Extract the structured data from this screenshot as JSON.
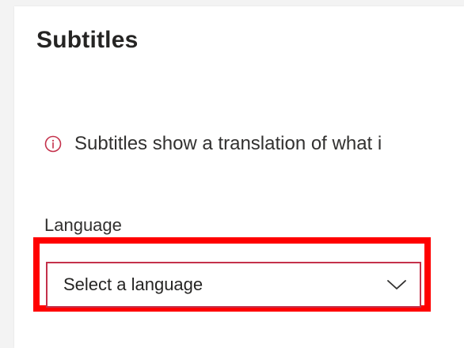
{
  "panel": {
    "title": "Subtitles",
    "info": {
      "icon": "info-icon",
      "text": "Subtitles show a translation of what i",
      "icon_color": "#c4314b"
    },
    "language": {
      "label": "Language",
      "select": {
        "value": "Select a language",
        "icon": "chevron-down-icon",
        "border_color": "#c4314b"
      }
    },
    "highlight_color": "#ff0000"
  }
}
